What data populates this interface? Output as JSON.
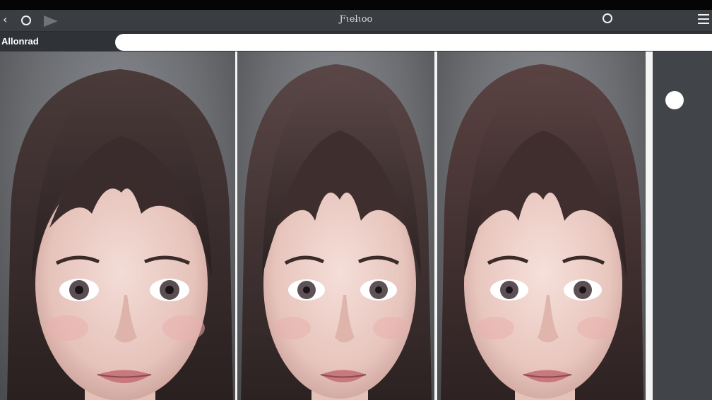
{
  "window": {
    "title": "Ƒɩeƚɩoo"
  },
  "toolbar": {
    "label": "Allonrad",
    "search_value": ""
  },
  "icons": {
    "back": "back-icon",
    "circle_left": "circle-icon",
    "play": "play-icon",
    "circle_right": "circle-icon",
    "menu": "menu-icon"
  },
  "gallery": {
    "images": [
      {
        "name": "portrait-1"
      },
      {
        "name": "portrait-2"
      },
      {
        "name": "portrait-3"
      }
    ]
  },
  "colors": {
    "titlebar": "#3a3d41",
    "toolbar": "#2f3236",
    "sidebar": "#414448"
  }
}
